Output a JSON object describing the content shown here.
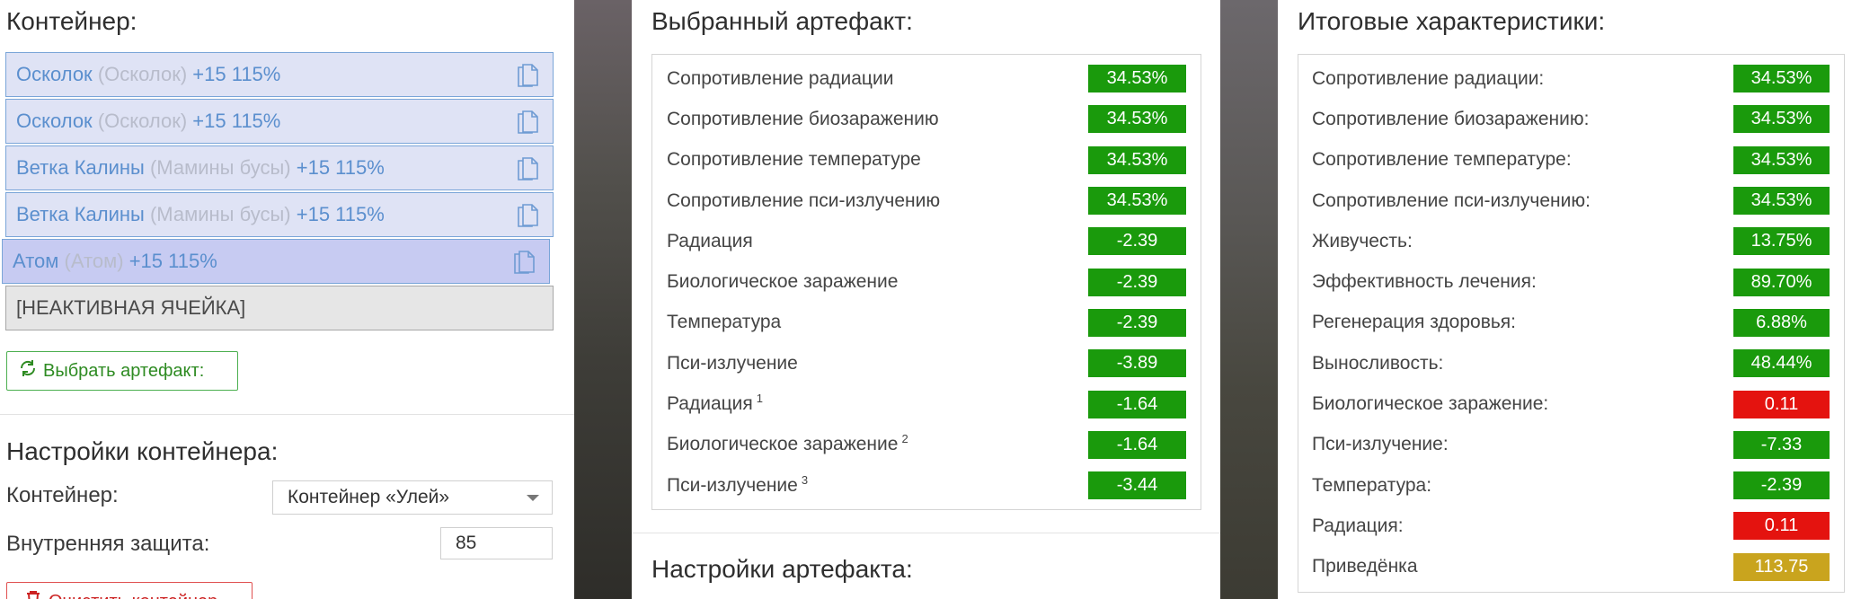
{
  "container": {
    "title": "Контейнер:",
    "slots": [
      {
        "name": "Осколок",
        "alt": "(Осколок)",
        "bonus": "+15 115%"
      },
      {
        "name": "Осколок",
        "alt": "(Осколок)",
        "bonus": "+15 115%"
      },
      {
        "name": "Ветка Калины",
        "alt": "(Мамины бусы)",
        "bonus": "+15 115%"
      },
      {
        "name": "Ветка Калины",
        "alt": "(Мамины бусы)",
        "bonus": "+15 115%"
      },
      {
        "name": "Атом",
        "alt": "(Атом)",
        "bonus": "+15 115%"
      }
    ],
    "inactive_slot": "[НЕАКТИВНАЯ ЯЧЕЙКА]",
    "choose_button": "Выбрать артефакт:",
    "settings_title": "Настройки контейнера:",
    "container_label": "Контейнер:",
    "container_value": "Контейнер «Улей»",
    "protection_label": "Внутренняя защита:",
    "protection_value": "85",
    "clear_button": "Очистить контейнер"
  },
  "selected": {
    "title": "Выбранный артефакт:",
    "rows": [
      {
        "label": "Сопротивление радиации",
        "sup": "",
        "value": "34.53%",
        "color": "green"
      },
      {
        "label": "Сопротивление биозаражению",
        "sup": "",
        "value": "34.53%",
        "color": "green"
      },
      {
        "label": "Сопротивление температуре",
        "sup": "",
        "value": "34.53%",
        "color": "green"
      },
      {
        "label": "Сопротивление пси-излучению",
        "sup": "",
        "value": "34.53%",
        "color": "green"
      },
      {
        "label": "Радиация",
        "sup": "",
        "value": "-2.39",
        "color": "green"
      },
      {
        "label": "Биологическое заражение",
        "sup": "",
        "value": "-2.39",
        "color": "green"
      },
      {
        "label": "Температура",
        "sup": "",
        "value": "-2.39",
        "color": "green"
      },
      {
        "label": "Пси-излучение",
        "sup": "",
        "value": "-3.89",
        "color": "green"
      },
      {
        "label": "Радиация",
        "sup": "1",
        "value": "-1.64",
        "color": "green"
      },
      {
        "label": "Биологическое заражение",
        "sup": "2",
        "value": "-1.64",
        "color": "green"
      },
      {
        "label": "Пси-излучение",
        "sup": "3",
        "value": "-3.44",
        "color": "green"
      }
    ],
    "settings_title": "Настройки артефакта:"
  },
  "totals": {
    "title": "Итоговые характеристики:",
    "rows": [
      {
        "label": "Сопротивление радиации:",
        "value": "34.53%",
        "color": "green"
      },
      {
        "label": "Сопротивление биозаражению:",
        "value": "34.53%",
        "color": "green"
      },
      {
        "label": "Сопротивление температуре:",
        "value": "34.53%",
        "color": "green"
      },
      {
        "label": "Сопротивление пси-излучению:",
        "value": "34.53%",
        "color": "green"
      },
      {
        "label": "Живучесть:",
        "value": "13.75%",
        "color": "green"
      },
      {
        "label": "Эффективность лечения:",
        "value": "89.70%",
        "color": "green"
      },
      {
        "label": "Регенерация здоровья:",
        "value": "6.88%",
        "color": "green"
      },
      {
        "label": "Выносливость:",
        "value": "48.44%",
        "color": "green"
      },
      {
        "label": "Биологическое заражение:",
        "value": "0.11",
        "color": "red"
      },
      {
        "label": "Пси-излучение:",
        "value": "-7.33",
        "color": "green"
      },
      {
        "label": "Температура:",
        "value": "-2.39",
        "color": "green"
      },
      {
        "label": "Радиация:",
        "value": "0.11",
        "color": "red"
      },
      {
        "label": "Приведёнка",
        "value": "113.75",
        "color": "gold"
      }
    ]
  },
  "colors": {
    "green": "#1a9a0c",
    "red": "#e4130f",
    "gold": "#c9a41e",
    "slot_text": "#5b8fce"
  }
}
